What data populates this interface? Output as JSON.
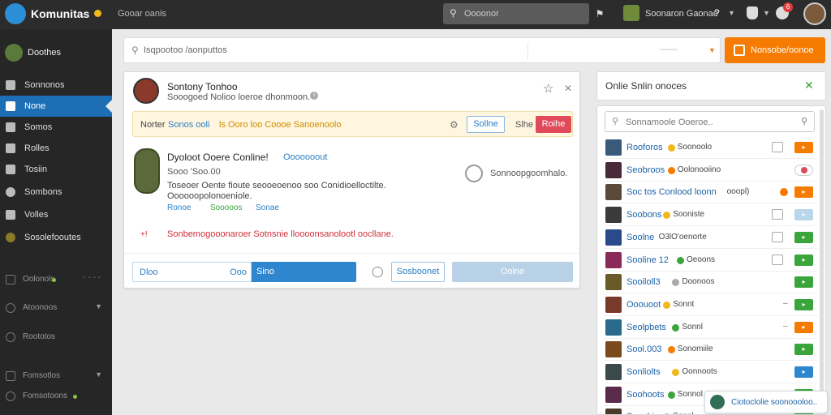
{
  "topbar": {
    "brand": "Komunitas",
    "link": "Gooar oanis",
    "search_placeholder": "Oooonor",
    "user": "Soonaron Gaonae"
  },
  "sidebar": {
    "profile_name": "Doothes",
    "items": [
      {
        "label": "Sonnonos",
        "icon": "grid-icon"
      },
      {
        "label": "None",
        "icon": "home-icon",
        "active": true
      },
      {
        "label": "Somos",
        "icon": "hammer-icon"
      },
      {
        "label": "Rolles",
        "icon": "wrench-icon"
      },
      {
        "label": "Tosiin",
        "icon": "bag-icon"
      },
      {
        "label": "Sombons",
        "icon": "globe-icon"
      },
      {
        "label": "Volles",
        "icon": "list-icon"
      },
      {
        "label": "Sosolefooutes",
        "icon": "game-icon"
      }
    ],
    "sections": [
      {
        "label": "Oolonols",
        "icon": "calendar-icon"
      },
      {
        "label": "Atoonoos",
        "icon": "clock-icon"
      },
      {
        "label": "Roototos",
        "icon": "circle-icon"
      },
      {
        "label": "Fomsotlos",
        "icon": "table-icon"
      },
      {
        "label": "Fomsotoons",
        "icon": "game-icon"
      }
    ]
  },
  "search": {
    "placeholder": "Isqpootoo /aonputtos",
    "dash": "——"
  },
  "orange_button": "Nonsobe/oonoe",
  "card": {
    "title": "Sontony Tonhoo",
    "subtitle": "Sooogoed Nolioo loeroe dhonmoon.",
    "notice": {
      "prefix": "Norter",
      "link": "Sonos ooli",
      "highlight": "ls Ooro loo Coooe Sanoenoolo",
      "btn1": "Sollne",
      "sep": "Slhe",
      "btn2": "Roihe"
    },
    "game": {
      "title": "Dyoloot Ooere Conline!",
      "link": "Ooooooout",
      "price": "Sooo 'Soo.00",
      "desc1": "Toseoer Oente fioute seooeoenoo soo Conidioelloctilte.",
      "desc2": "Oooooopolonoeniole.",
      "tags": [
        "Ronoe",
        "Sooooos",
        "Sonae"
      ]
    },
    "side_label": "Sonnoopgoomhalo.",
    "red_text": "Sonbemogooonaroer Sotnsnie lloooonsanolootl oocllane.",
    "footer": {
      "input_left": "Dloo",
      "input_right": "Ooo",
      "split_btn": "Sino",
      "btn": "Sosboonet",
      "btn2": "Oolne"
    }
  },
  "right_panel": {
    "title": "Onlie Snlin onoces",
    "search_placeholder": "Sonnamoole Ooeroe..",
    "rows": [
      {
        "name": "Rooforos",
        "status": "Soonoolo",
        "dot": "#f1b81d",
        "av": "#3a5a7a",
        "mid": "box",
        "act": "#f57c00"
      },
      {
        "name": "Seobroos",
        "status": "Oolonooiino",
        "dot": "#f57c00",
        "av": "#4a2a3a",
        "mid": "none",
        "act": "toggle"
      },
      {
        "name": "Soc tos Conlood loonn",
        "status": "ooopl)",
        "dot": "",
        "av": "#5a4a3a",
        "mid": "dot",
        "act": "#f57c00"
      },
      {
        "name": "Soobons",
        "status": "Sooniste",
        "dot": "#f1b81d",
        "av": "#3a3a3a",
        "mid": "box",
        "act": "#b9d7ea"
      },
      {
        "name": "Soolne",
        "status": "O3lO'oenorte",
        "dot": "",
        "av": "#2a4a8a",
        "mid": "box",
        "act": "#3aa53a"
      },
      {
        "name": "Sooline 12",
        "status": "Oeoons",
        "dot": "#3aa53a",
        "av": "#8a2a5a",
        "mid": "box",
        "act": "#3aa53a"
      },
      {
        "name": "Sooiloll3",
        "status": "Doonoos",
        "dot": "#aaa",
        "av": "#6a5a2a",
        "mid": "none",
        "act": "#3aa53a"
      },
      {
        "name": "Ooouoot",
        "status": "Sonnt",
        "dot": "#f1b81d",
        "av": "#7a3a2a",
        "mid": "dash",
        "act": "#3aa53a"
      },
      {
        "name": "Seolpbets",
        "status": "Sonnl",
        "dot": "#3aa53a",
        "av": "#2a6a8a",
        "mid": "dash",
        "act": "#f57c00"
      },
      {
        "name": "Sool.003",
        "status": "Sonomiile",
        "dot": "#f57c00",
        "av": "#7a4a1a",
        "mid": "none",
        "act": "#3aa53a"
      },
      {
        "name": "Sonliolts",
        "status": "Oonnoots",
        "dot": "#f1b81d",
        "av": "#3a4a4a",
        "mid": "none",
        "act": "#2e86cf"
      },
      {
        "name": "Soohoots",
        "status": "Sonnol",
        "dot": "#3aa53a",
        "av": "#5a2a4a",
        "mid": "none",
        "act": "#3aa53a"
      },
      {
        "name": "Sooobis",
        "status": "Sonnl",
        "dot": "#aaa",
        "av": "#4a3a2a",
        "mid": "none",
        "act": "#3aa53a"
      }
    ]
  },
  "toast": "Ciotoclolie soonoooloo.."
}
